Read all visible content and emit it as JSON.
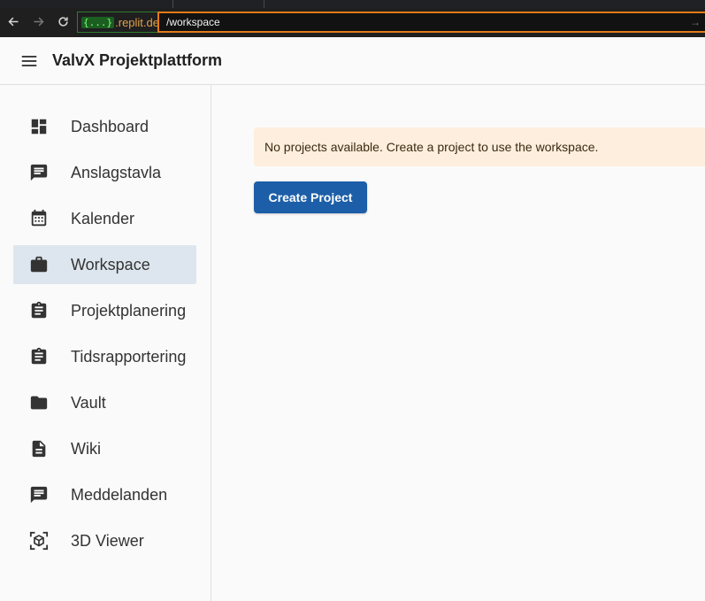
{
  "browser": {
    "url_origin_badge": "{...}",
    "url_origin_host": ".replit.dev",
    "url_path": "/workspace"
  },
  "header": {
    "title": "ValvX Projektplattform",
    "menu_icon": "hamburger-menu-icon"
  },
  "sidebar": {
    "items": [
      {
        "label": "Dashboard",
        "icon": "dashboard-icon",
        "active": false
      },
      {
        "label": "Anslagstavla",
        "icon": "message-icon",
        "active": false
      },
      {
        "label": "Kalender",
        "icon": "calendar-icon",
        "active": false
      },
      {
        "label": "Workspace",
        "icon": "briefcase-icon",
        "active": true
      },
      {
        "label": "Projektplanering",
        "icon": "clipboard-icon",
        "active": false
      },
      {
        "label": "Tidsrapportering",
        "icon": "clipboard-icon",
        "active": false
      },
      {
        "label": "Vault",
        "icon": "folder-icon",
        "active": false
      },
      {
        "label": "Wiki",
        "icon": "document-icon",
        "active": false
      },
      {
        "label": "Meddelanden",
        "icon": "message-icon",
        "active": false
      },
      {
        "label": "3D Viewer",
        "icon": "3d-cube-icon",
        "active": false
      }
    ]
  },
  "main": {
    "alert_text": "No projects available. Create a project to use the workspace.",
    "create_button_label": "Create Project"
  },
  "colors": {
    "primary": "#1c5ea7",
    "alert_bg": "#fdeedd",
    "active_item_bg": "#dde6ee",
    "url_focus_border": "#e37b16"
  }
}
